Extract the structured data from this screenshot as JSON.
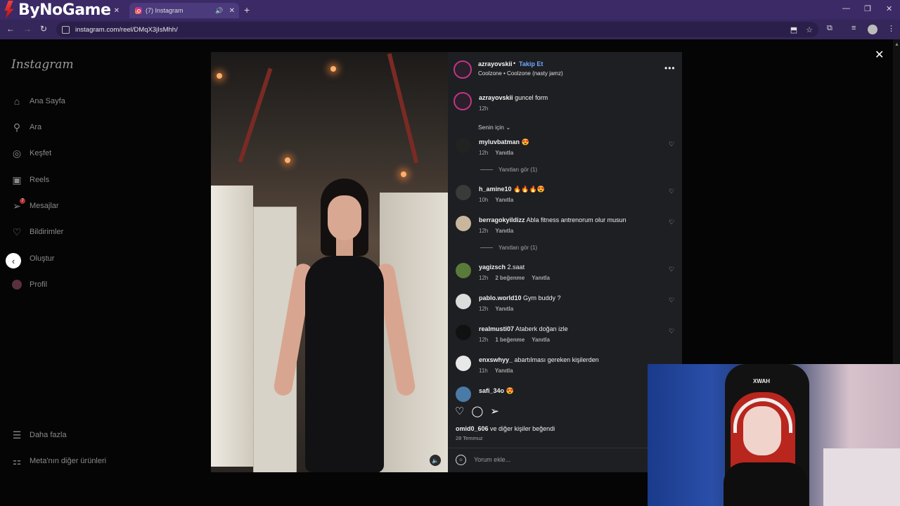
{
  "browser": {
    "brand": "ByNoGame",
    "tabs": [
      {
        "label": ""
      },
      {
        "label": "(7) Instagram"
      }
    ],
    "url": "instagram.com/reel/DMqX3jIsMhh/"
  },
  "sidebar": {
    "logo": "Instagram",
    "items": [
      {
        "label": "Ana Sayfa",
        "icon": "home-icon"
      },
      {
        "label": "Ara",
        "icon": "search-icon"
      },
      {
        "label": "Keşfet",
        "icon": "explore-icon"
      },
      {
        "label": "Reels",
        "icon": "reels-icon"
      },
      {
        "label": "Mesajlar",
        "icon": "messages-icon",
        "badge": "7"
      },
      {
        "label": "Bildirimler",
        "icon": "heart-icon"
      },
      {
        "label": "Oluştur",
        "icon": "create-icon"
      },
      {
        "label": "Profil",
        "icon": "avatar-icon"
      }
    ],
    "more": "Daha fazla",
    "meta": "Meta'nın diğer ürünleri"
  },
  "post": {
    "username": "azrayovskii",
    "follow": "Takip Et",
    "audio": "Coolzone • Coolzone (nasty jamz)",
    "caption_user": "azrayovskii",
    "caption": "guncel form",
    "caption_time": "12h",
    "sort": "Senin için",
    "likes_user": "omid0_606",
    "likes_rest": "ve diğer kişiler beğendi",
    "date": "28 Temmuz",
    "comment_placeholder": "Yorum ekle..."
  },
  "comments": [
    {
      "user": "myluvbatman",
      "text": "😍",
      "time": "12h",
      "likes": "",
      "reply": "Yanıtla",
      "replies": "Yanıtları gör (1)"
    },
    {
      "user": "h_amine10",
      "text": "🔥🔥🔥😍",
      "time": "10h",
      "likes": "",
      "reply": "Yanıtla",
      "replies": ""
    },
    {
      "user": "berragokyildizz",
      "text": "Abla fitness antrenorum olur musun",
      "time": "12h",
      "likes": "",
      "reply": "Yanıtla",
      "replies": "Yanıtları gör (1)"
    },
    {
      "user": "yagizsch",
      "text": "2.saat",
      "time": "12h",
      "likes": "2 beğenme",
      "reply": "Yanıtla",
      "replies": ""
    },
    {
      "user": "pablo.world10",
      "text": "Gym buddy ?",
      "time": "12h",
      "likes": "",
      "reply": "Yanıtla",
      "replies": ""
    },
    {
      "user": "realmusti07",
      "text": "Ataberk doğan izle",
      "time": "12h",
      "likes": "1 beğenme",
      "reply": "Yanıtla",
      "replies": ""
    },
    {
      "user": "enxswhyy_",
      "text": "abartılması gereken kişilerden",
      "time": "11h",
      "likes": "",
      "reply": "Yanıtla",
      "replies": ""
    },
    {
      "user": "safi_34o",
      "text": "😍",
      "time": "",
      "likes": "",
      "reply": "",
      "replies": ""
    }
  ],
  "webcam": {
    "logo": "XWAH"
  }
}
